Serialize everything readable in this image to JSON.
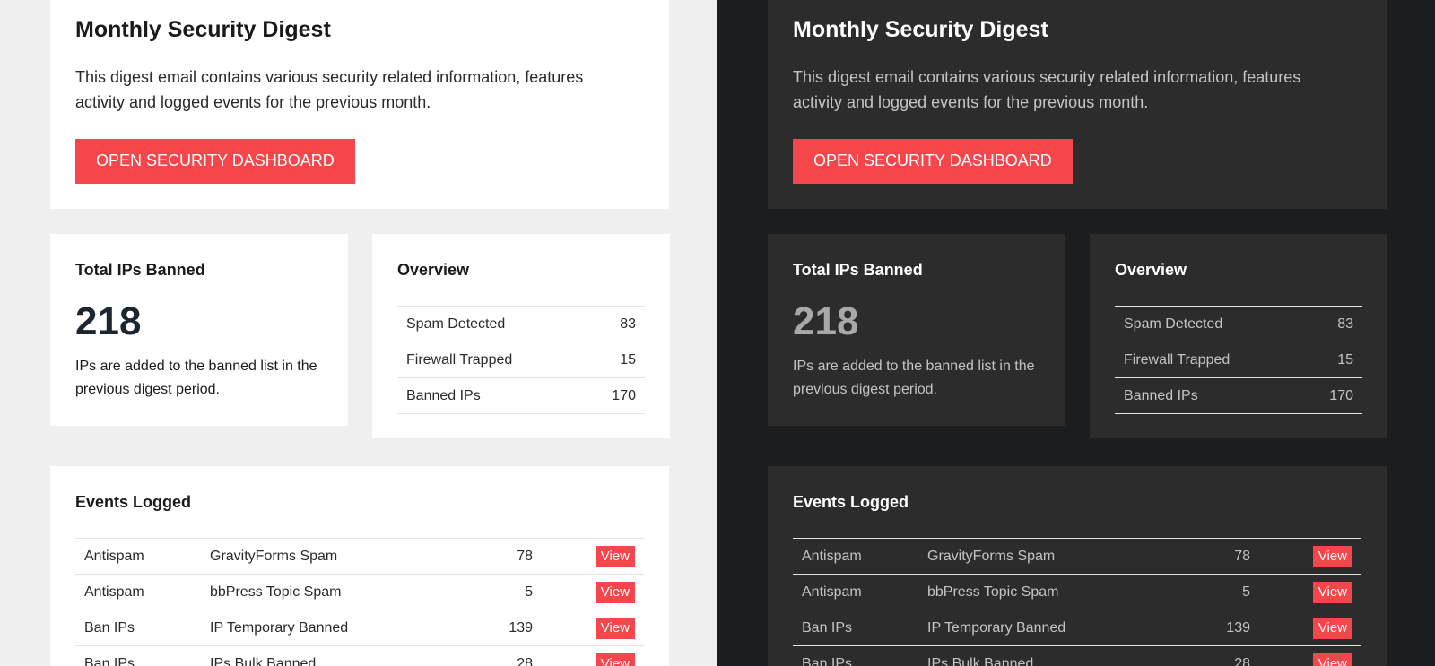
{
  "digest": {
    "title": "Monthly Security Digest",
    "description": "This digest email contains various security related information, features activity and logged events for the previous month.",
    "cta_label": "OPEN SECURITY DASHBOARD"
  },
  "ips_banned": {
    "title": "Total IPs Banned",
    "value": "218",
    "description": "IPs are added to the banned list in the previous digest period."
  },
  "overview": {
    "title": "Overview",
    "rows": [
      {
        "label": "Spam Detected",
        "value": "83"
      },
      {
        "label": "Firewall Trapped",
        "value": "15"
      },
      {
        "label": "Banned IPs",
        "value": "170"
      }
    ]
  },
  "events": {
    "title": "Events Logged",
    "view_label": "View",
    "rows": [
      {
        "category": "Antispam",
        "event": "GravityForms Spam",
        "count": "78"
      },
      {
        "category": "Antispam",
        "event": "bbPress Topic Spam",
        "count": "5"
      },
      {
        "category": "Ban IPs",
        "event": "IP Temporary Banned",
        "count": "139"
      },
      {
        "category": "Ban IPs",
        "event": "IPs Bulk Banned",
        "count": "28"
      }
    ]
  },
  "colors": {
    "accent": "#f5464b",
    "light_bg": "#efefef",
    "light_card": "#ffffff",
    "dark_bg": "#1c1d1f",
    "dark_card": "#2c2c2c"
  }
}
